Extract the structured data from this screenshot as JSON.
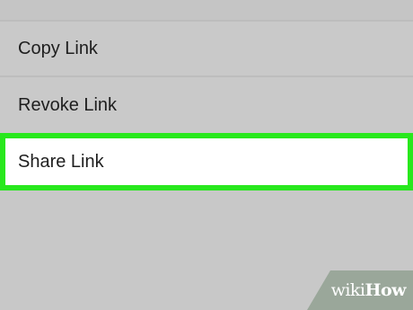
{
  "menu": {
    "items": [
      {
        "label": "Copy Link"
      },
      {
        "label": "Revoke Link"
      },
      {
        "label": "Share Link"
      }
    ]
  },
  "watermark": {
    "prefix": "wiki",
    "suffix": "How"
  },
  "colors": {
    "background": "#c9c9c9",
    "highlight_border": "#28e81d",
    "highlight_fill": "#ffffff",
    "text": "#1e1e1e"
  }
}
